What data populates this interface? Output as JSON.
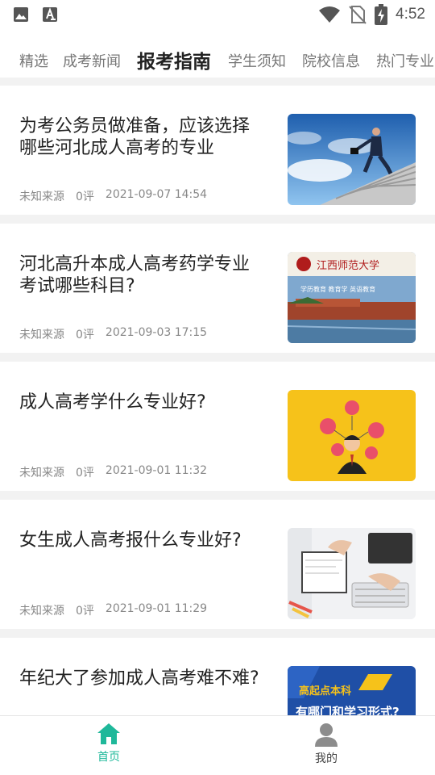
{
  "status_bar": {
    "time": "4:52",
    "icons": [
      "image-icon",
      "text-icon",
      "wifi-icon",
      "no-sim-icon",
      "battery-charging-icon"
    ]
  },
  "tabs": [
    {
      "label": "精选"
    },
    {
      "label": "成考新闻"
    },
    {
      "label": "报考指南",
      "active": true
    },
    {
      "label": "学生须知"
    },
    {
      "label": "院校信息"
    },
    {
      "label": "热门专业"
    }
  ],
  "articles": [
    {
      "title": "为考公务员做准备，应该选择哪些河北成人高考的专业",
      "source": "未知来源",
      "comments": "0评",
      "date": "2021-09-07 14:54",
      "thumb": "businessman-stairs-image"
    },
    {
      "title": "河北高升本成人高考药学专业考试哪些科目?",
      "source": "未知来源",
      "comments": "0评",
      "date": "2021-09-03 17:15",
      "thumb": "university-campus-image",
      "thumb_text": {
        "name": "江西师范大学",
        "slogan": "学历教育  教育学  英语教育"
      }
    },
    {
      "title": "成人高考学什么专业好?",
      "source": "未知来源",
      "comments": "0评",
      "date": "2021-09-01 11:32",
      "thumb": "person-icons-yellow-image"
    },
    {
      "title": "女生成人高考报什么专业好?",
      "source": "未知来源",
      "comments": "0评",
      "date": "2021-09-01 11:29",
      "thumb": "desk-writing-image"
    },
    {
      "title": "年纪大了参加成人高考难不难?",
      "source": "",
      "comments": "",
      "date": "",
      "thumb": "blue-banner-image",
      "thumb_text": {
        "line1": "高起点本科",
        "line2": "有哪门和学习形式?"
      }
    }
  ],
  "bottom_nav": [
    {
      "label": "首页",
      "icon": "home-icon",
      "active": true,
      "color": "#1fb89a"
    },
    {
      "label": "我的",
      "icon": "user-icon",
      "active": false,
      "color": "#555555"
    }
  ],
  "colors": {
    "accent": "#1fb89a",
    "thumb_yellow": "#f6c21a",
    "thumb_blue": "#1f4fa6"
  }
}
